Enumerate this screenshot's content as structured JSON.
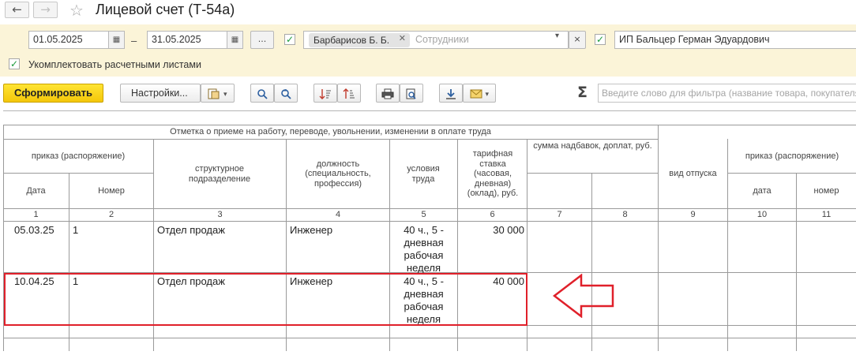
{
  "window": {
    "title": "Лицевой счет (Т-54а)",
    "back_glyph": "←",
    "forward_glyph": "→",
    "favorite_glyph": "☆"
  },
  "filters": {
    "date_from": "01.05.2025",
    "date_to": "31.05.2025",
    "period_separator": "–",
    "calendar_glyph": "▦",
    "period_select_label": "...",
    "employees_enabled": true,
    "employee_tag": "Барбарисов Б. Б.",
    "employee_tag_remove": "✕",
    "employees_placeholder": "Сотрудники",
    "dropdown_glyph": "▾",
    "clear_glyph": "×",
    "organization_enabled": true,
    "organization": "ИП Бальцер Герман Эдуардович",
    "payslips_enabled": true,
    "payslips_label": "Укомплектовать расчетными листами",
    "check_glyph": "✓"
  },
  "toolbar": {
    "generate_label": "Сформировать",
    "settings_label": "Настройки...",
    "variant_icon": "report-variants-icon",
    "search_icon": "search-icon",
    "search_next_icon": "search-next-icon",
    "sort_asc_icon": "sort-ascending-icon",
    "sort_desc_icon": "sort-descending-icon",
    "print_icon": "printer-icon",
    "preview_icon": "print-preview-icon",
    "save_icon": "download-icon",
    "mail_icon": "envelope-icon",
    "sum_glyph": "Σ",
    "filter_placeholder": "Введите слово для фильтра (название товара, покупателя..."
  },
  "report": {
    "header_top": "Отметка о приеме на работу, переводе, увольнении, изменении в оплате труда",
    "order_group": "приказ (распоряжение)",
    "col_date": "Дата",
    "col_number": "Номер",
    "col_department": "структурное подразделение",
    "col_position": "должность (специальность, профессия)",
    "col_conditions": "условия труда",
    "col_rate": "тарифная ставка (часовая, дневная) (оклад), руб.",
    "col_allowances": "сумма надбавок, доплат, руб.",
    "col_leave_type": "вид отпуска",
    "order_group_2": "приказ (распоряжение)",
    "col_date_2": "дата",
    "col_number_2": "номер",
    "col_numbers": [
      "1",
      "2",
      "3",
      "4",
      "5",
      "6",
      "7",
      "8",
      "9",
      "10",
      "11"
    ],
    "rows": [
      {
        "date": "05.03.25",
        "number": "1",
        "department": "Отдел продаж",
        "position": "Инженер",
        "conditions": "40 ч., 5 - дневная рабочая неделя",
        "rate": "30 000"
      },
      {
        "date": "10.04.25",
        "number": "1",
        "department": "Отдел продаж",
        "position": "Инженер",
        "conditions": "40 ч., 5 - дневная рабочая неделя",
        "rate": "40 000"
      }
    ],
    "highlight_color": "#e0202a"
  }
}
